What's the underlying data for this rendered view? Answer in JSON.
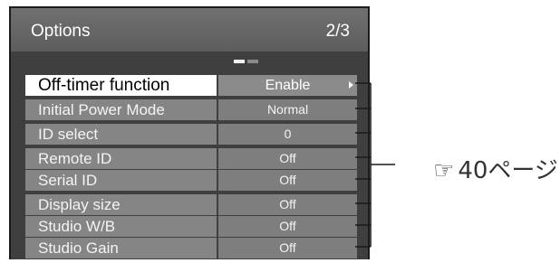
{
  "menu": {
    "title": "Options",
    "page": "2/3",
    "items": [
      {
        "label": "Off-timer function",
        "value": "Enable",
        "selected": true
      },
      {
        "label": "Initial Power Mode",
        "value": "Normal"
      },
      {
        "label": "ID select",
        "value": "0"
      },
      {
        "label": "Remote ID",
        "value": "Off"
      },
      {
        "label": "Serial ID",
        "value": "Off"
      },
      {
        "label": "Display size",
        "value": "Off"
      },
      {
        "label": "Studio W/B",
        "value": "Off"
      },
      {
        "label": "Studio Gain",
        "value": "Off"
      }
    ]
  },
  "reference": {
    "icon": "pointing-hand-icon",
    "text": "40ページ"
  }
}
